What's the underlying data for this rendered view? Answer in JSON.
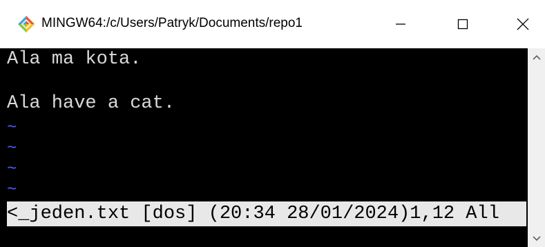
{
  "window": {
    "title": "MINGW64:/c/Users/Patryk/Documents/repo1",
    "icon": "git-diamond-icon"
  },
  "controls": {
    "minimize": "minimize-icon",
    "maximize": "maximize-icon",
    "close": "close-icon"
  },
  "editor": {
    "lines": [
      "Ala ma kota.",
      "",
      "Ala have a cat."
    ],
    "tilde": "~",
    "status": "<_jeden.txt [dos] (20:34 28/01/2024)1,12 All"
  },
  "colors": {
    "background": "#000000",
    "text": "#d9d9d9",
    "tilde": "#5a5aff",
    "status_bg": "#e8e8e8"
  }
}
